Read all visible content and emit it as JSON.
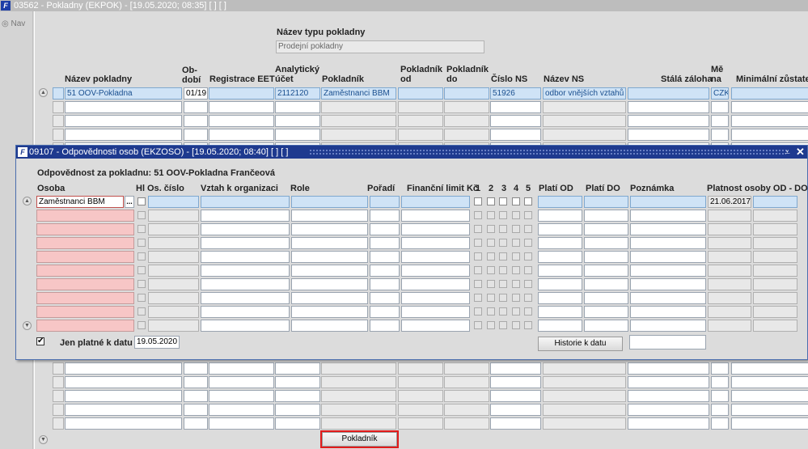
{
  "window": {
    "title": "03562 - Pokladny (EKPOK) - [19.05.2020; 08:35]  [ ]  [ ]"
  },
  "nav": {
    "label": "Nav"
  },
  "filter": {
    "label": "Název typu pokladny",
    "value": "Prodejní pokladny"
  },
  "grid": {
    "headers": {
      "nazev": "Název pokladny",
      "obdobi": "Ob-dobí",
      "eet": "Registrace EET",
      "ucet": "Analytický účet",
      "pokladnik": "Pokladník",
      "od": "Pokladník od",
      "do": "Pokladník do",
      "cislo_ns": "Číslo NS",
      "nazev_ns": "Název NS",
      "zaloha": "Stálá záloha",
      "mena": "Mě na",
      "min": "Minimální zůstatek"
    },
    "row1": {
      "nazev": "51 OOV-Pokladna",
      "obdobi": "01/19",
      "ucet": "2112120",
      "pokladnik": "Zaměstnanci BBM",
      "cislo_ns": "51926",
      "nazev_ns": "odbor vnějších vztahů",
      "mena": "CZK"
    }
  },
  "dialog": {
    "title": "09107 - Odpovědnosti osob (EKZOSO) - [19.05.2020; 08:40]  [ ]  [ ]",
    "subtitle": "Odpovědnost za pokladnu: 51 OOV-Pokladna Frančeová",
    "headers": {
      "osoba": "Osoba",
      "hl": "Hl",
      "os_cislo": "Os. číslo",
      "vztah": "Vztah k organizaci",
      "role": "Role",
      "poradi": "Pořadí",
      "limit": "Finanční limit Kč",
      "c1": "1",
      "c2": "2",
      "c3": "3",
      "c4": "4",
      "c5": "5",
      "plati_od": "Platí OD",
      "plati_do": "Platí DO",
      "poznamka": "Poznámka",
      "platnost": "Platnost osoby OD - DO"
    },
    "row1": {
      "osoba": "Zaměstnanci BBM",
      "lov": "...",
      "platnost": "21.06.2017"
    },
    "jen_platne": {
      "label": "Jen platné k datu",
      "checked": true,
      "date": "19.05.2020"
    },
    "historie_button": "Historie k datu"
  },
  "bottom_button": "Pokladník",
  "colors": {
    "dialog_title": "#1e3a8f",
    "selected_row": "#cfe3f6",
    "required": "#f7c6c6",
    "highlight": "#e21b1b"
  }
}
